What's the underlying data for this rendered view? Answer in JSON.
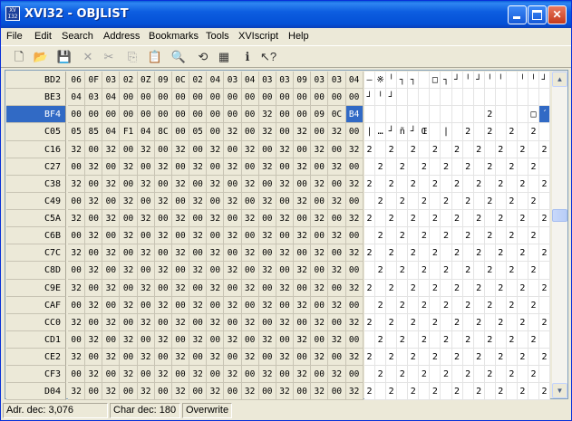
{
  "window": {
    "title": "XVI32 - OBJLIST",
    "app_icon_text": "XVI32"
  },
  "menubar": {
    "items": [
      "File",
      "Edit",
      "Search",
      "Address",
      "Bookmarks",
      "Tools",
      "XVIscript",
      "Help"
    ]
  },
  "toolbar": {
    "tools": [
      {
        "name": "new-file-icon",
        "glyph": "🗋",
        "enabled": true
      },
      {
        "name": "open-folder-icon",
        "glyph": "📂",
        "enabled": true
      },
      {
        "name": "save-icon",
        "glyph": "💾",
        "enabled": true
      },
      {
        "name": "delete-icon",
        "glyph": "✕",
        "enabled": false
      },
      {
        "name": "cut-icon",
        "glyph": "✂",
        "enabled": false
      },
      {
        "name": "copy-icon",
        "glyph": "⎘",
        "enabled": false
      },
      {
        "name": "paste-icon",
        "glyph": "📋",
        "enabled": false
      },
      {
        "name": "find-icon",
        "glyph": "🔍",
        "enabled": true
      },
      {
        "name": "replace-icon",
        "glyph": "⟲",
        "enabled": true
      },
      {
        "name": "properties-icon",
        "glyph": "▦",
        "enabled": true
      },
      {
        "name": "info-icon",
        "glyph": "ℹ",
        "enabled": true
      },
      {
        "name": "context-help-icon",
        "glyph": "↖?",
        "enabled": true
      }
    ]
  },
  "grid": {
    "rows": [
      {
        "addr": "BD2",
        "hex": [
          "06",
          "0F",
          "03",
          "02",
          "0Z",
          "09",
          "0C",
          "02",
          "04",
          "03",
          "04",
          "03",
          "03",
          "09",
          "03",
          "03",
          "04"
        ],
        "text": [
          "–",
          "※",
          "╵",
          "┐",
          "┐",
          " ",
          "□",
          "┐",
          "┘",
          "╵",
          "┘",
          "╵",
          "╵",
          " ",
          "╵",
          "╵",
          "┘"
        ]
      },
      {
        "addr": "BE3",
        "hex": [
          "04",
          "03",
          "04",
          "00",
          "00",
          "00",
          "00",
          "00",
          "00",
          "00",
          "00",
          "00",
          "00",
          "00",
          "00",
          "00",
          "00"
        ],
        "text": [
          "┘",
          "╵",
          "┘",
          " ",
          " ",
          " ",
          " ",
          " ",
          " ",
          " ",
          " ",
          " ",
          " ",
          " ",
          " ",
          " ",
          " "
        ]
      },
      {
        "addr": "BF4",
        "hex": [
          "00",
          "00",
          "00",
          "00",
          "00",
          "00",
          "00",
          "00",
          "00",
          "00",
          "00",
          "32",
          "00",
          "00",
          "09",
          "0C",
          "B4"
        ],
        "text": [
          " ",
          " ",
          " ",
          " ",
          " ",
          " ",
          " ",
          " ",
          " ",
          " ",
          " ",
          "2",
          " ",
          " ",
          " ",
          "□",
          "´"
        ],
        "selected": true
      },
      {
        "addr": "C05",
        "hex": [
          "05",
          "85",
          "04",
          "F1",
          "04",
          "8C",
          "00",
          "05",
          "00",
          "32",
          "00",
          "32",
          "00",
          "32",
          "00",
          "32",
          "00"
        ],
        "text": [
          "|",
          "…",
          "┘",
          "ñ",
          "┘",
          "Œ",
          " ",
          "|",
          " ",
          "2",
          " ",
          "2",
          " ",
          "2",
          " ",
          "2",
          " "
        ]
      },
      {
        "addr": "C16",
        "hex": [
          "32",
          "00",
          "32",
          "00",
          "32",
          "00",
          "32",
          "00",
          "32",
          "00",
          "32",
          "00",
          "32",
          "00",
          "32",
          "00",
          "32"
        ],
        "text": [
          "2",
          " ",
          "2",
          " ",
          "2",
          " ",
          "2",
          " ",
          "2",
          " ",
          "2",
          " ",
          "2",
          " ",
          "2",
          " ",
          "2"
        ]
      },
      {
        "addr": "C27",
        "hex": [
          "00",
          "32",
          "00",
          "32",
          "00",
          "32",
          "00",
          "32",
          "00",
          "32",
          "00",
          "32",
          "00",
          "32",
          "00",
          "32",
          "00"
        ],
        "text": [
          " ",
          "2",
          " ",
          "2",
          " ",
          "2",
          " ",
          "2",
          " ",
          "2",
          " ",
          "2",
          " ",
          "2",
          " ",
          "2",
          " "
        ]
      },
      {
        "addr": "C38",
        "hex": [
          "32",
          "00",
          "32",
          "00",
          "32",
          "00",
          "32",
          "00",
          "32",
          "00",
          "32",
          "00",
          "32",
          "00",
          "32",
          "00",
          "32"
        ],
        "text": [
          "2",
          " ",
          "2",
          " ",
          "2",
          " ",
          "2",
          " ",
          "2",
          " ",
          "2",
          " ",
          "2",
          " ",
          "2",
          " ",
          "2"
        ]
      },
      {
        "addr": "C49",
        "hex": [
          "00",
          "32",
          "00",
          "32",
          "00",
          "32",
          "00",
          "32",
          "00",
          "32",
          "00",
          "32",
          "00",
          "32",
          "00",
          "32",
          "00"
        ],
        "text": [
          " ",
          "2",
          " ",
          "2",
          " ",
          "2",
          " ",
          "2",
          " ",
          "2",
          " ",
          "2",
          " ",
          "2",
          " ",
          "2",
          " "
        ]
      },
      {
        "addr": "C5A",
        "hex": [
          "32",
          "00",
          "32",
          "00",
          "32",
          "00",
          "32",
          "00",
          "32",
          "00",
          "32",
          "00",
          "32",
          "00",
          "32",
          "00",
          "32"
        ],
        "text": [
          "2",
          " ",
          "2",
          " ",
          "2",
          " ",
          "2",
          " ",
          "2",
          " ",
          "2",
          " ",
          "2",
          " ",
          "2",
          " ",
          "2"
        ]
      },
      {
        "addr": "C6B",
        "hex": [
          "00",
          "32",
          "00",
          "32",
          "00",
          "32",
          "00",
          "32",
          "00",
          "32",
          "00",
          "32",
          "00",
          "32",
          "00",
          "32",
          "00"
        ],
        "text": [
          " ",
          "2",
          " ",
          "2",
          " ",
          "2",
          " ",
          "2",
          " ",
          "2",
          " ",
          "2",
          " ",
          "2",
          " ",
          "2",
          " "
        ]
      },
      {
        "addr": "C7C",
        "hex": [
          "32",
          "00",
          "32",
          "00",
          "32",
          "00",
          "32",
          "00",
          "32",
          "00",
          "32",
          "00",
          "32",
          "00",
          "32",
          "00",
          "32"
        ],
        "text": [
          "2",
          " ",
          "2",
          " ",
          "2",
          " ",
          "2",
          " ",
          "2",
          " ",
          "2",
          " ",
          "2",
          " ",
          "2",
          " ",
          "2"
        ]
      },
      {
        "addr": "C8D",
        "hex": [
          "00",
          "32",
          "00",
          "32",
          "00",
          "32",
          "00",
          "32",
          "00",
          "32",
          "00",
          "32",
          "00",
          "32",
          "00",
          "32",
          "00"
        ],
        "text": [
          " ",
          "2",
          " ",
          "2",
          " ",
          "2",
          " ",
          "2",
          " ",
          "2",
          " ",
          "2",
          " ",
          "2",
          " ",
          "2",
          " "
        ]
      },
      {
        "addr": "C9E",
        "hex": [
          "32",
          "00",
          "32",
          "00",
          "32",
          "00",
          "32",
          "00",
          "32",
          "00",
          "32",
          "00",
          "32",
          "00",
          "32",
          "00",
          "32"
        ],
        "text": [
          "2",
          " ",
          "2",
          " ",
          "2",
          " ",
          "2",
          " ",
          "2",
          " ",
          "2",
          " ",
          "2",
          " ",
          "2",
          " ",
          "2"
        ]
      },
      {
        "addr": "CAF",
        "hex": [
          "00",
          "32",
          "00",
          "32",
          "00",
          "32",
          "00",
          "32",
          "00",
          "32",
          "00",
          "32",
          "00",
          "32",
          "00",
          "32",
          "00"
        ],
        "text": [
          " ",
          "2",
          " ",
          "2",
          " ",
          "2",
          " ",
          "2",
          " ",
          "2",
          " ",
          "2",
          " ",
          "2",
          " ",
          "2",
          " "
        ]
      },
      {
        "addr": "CC0",
        "hex": [
          "32",
          "00",
          "32",
          "00",
          "32",
          "00",
          "32",
          "00",
          "32",
          "00",
          "32",
          "00",
          "32",
          "00",
          "32",
          "00",
          "32"
        ],
        "text": [
          "2",
          " ",
          "2",
          " ",
          "2",
          " ",
          "2",
          " ",
          "2",
          " ",
          "2",
          " ",
          "2",
          " ",
          "2",
          " ",
          "2"
        ]
      },
      {
        "addr": "CD1",
        "hex": [
          "00",
          "32",
          "00",
          "32",
          "00",
          "32",
          "00",
          "32",
          "00",
          "32",
          "00",
          "32",
          "00",
          "32",
          "00",
          "32",
          "00"
        ],
        "text": [
          " ",
          "2",
          " ",
          "2",
          " ",
          "2",
          " ",
          "2",
          " ",
          "2",
          " ",
          "2",
          " ",
          "2",
          " ",
          "2",
          " "
        ]
      },
      {
        "addr": "CE2",
        "hex": [
          "32",
          "00",
          "32",
          "00",
          "32",
          "00",
          "32",
          "00",
          "32",
          "00",
          "32",
          "00",
          "32",
          "00",
          "32",
          "00",
          "32"
        ],
        "text": [
          "2",
          " ",
          "2",
          " ",
          "2",
          " ",
          "2",
          " ",
          "2",
          " ",
          "2",
          " ",
          "2",
          " ",
          "2",
          " ",
          "2"
        ]
      },
      {
        "addr": "CF3",
        "hex": [
          "00",
          "32",
          "00",
          "32",
          "00",
          "32",
          "00",
          "32",
          "00",
          "32",
          "00",
          "32",
          "00",
          "32",
          "00",
          "32",
          "00"
        ],
        "text": [
          " ",
          "2",
          " ",
          "2",
          " ",
          "2",
          " ",
          "2",
          " ",
          "2",
          " ",
          "2",
          " ",
          "2",
          " ",
          "2",
          " "
        ]
      },
      {
        "addr": "D04",
        "hex": [
          "32",
          "00",
          "32",
          "00",
          "32",
          "00",
          "32",
          "00",
          "32",
          "00",
          "32",
          "00",
          "32",
          "00",
          "32",
          "00",
          "32"
        ],
        "text": [
          "2",
          " ",
          "2",
          " ",
          "2",
          " ",
          "2",
          " ",
          "2",
          " ",
          "2",
          " ",
          "2",
          " ",
          "2",
          " ",
          "2"
        ]
      }
    ],
    "cursor_row": 2,
    "cursor_col": 16
  },
  "statusbar": {
    "address": "Adr. dec: 3,076",
    "char": "Char dec: 180",
    "mode": "Overwrite"
  },
  "colors": {
    "selection": "#316ac5",
    "titlebar": "#0450d6"
  }
}
